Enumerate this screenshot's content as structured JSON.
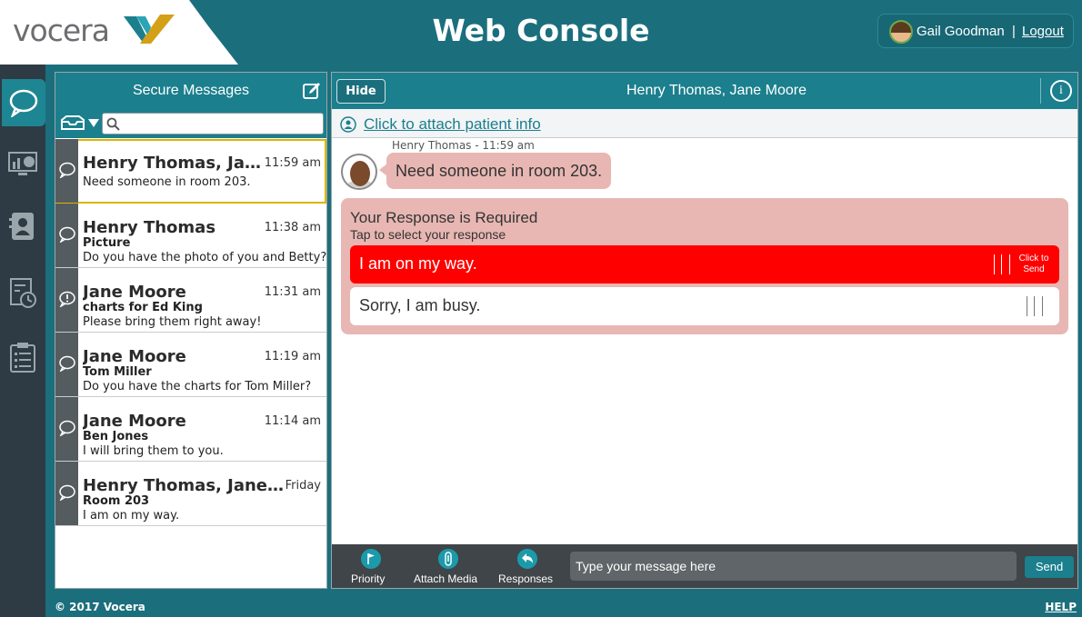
{
  "header": {
    "logo_text": "vocera",
    "app_title": "Web Console",
    "user_name": "Gail Goodman",
    "separator": "|",
    "logout_label": "Logout"
  },
  "nav": {
    "items": [
      {
        "name": "messages",
        "icon": "chat-bubble-icon",
        "active": true
      },
      {
        "name": "dashboard",
        "icon": "dashboard-chart-icon",
        "active": false
      },
      {
        "name": "contacts",
        "icon": "contact-card-icon",
        "active": false
      },
      {
        "name": "history",
        "icon": "history-clock-icon",
        "active": false
      },
      {
        "name": "tasks",
        "icon": "clipboard-icon",
        "active": false
      }
    ]
  },
  "list": {
    "title": "Secure Messages",
    "search_placeholder": "",
    "messages": [
      {
        "sender": "Henry Thomas, Jane Moore",
        "time": "11:59 am",
        "subject": "",
        "preview": "Need someone in room 203.",
        "icon": "chat-bubble-icon",
        "selected": true
      },
      {
        "sender": "Henry Thomas",
        "time": "11:38 am",
        "subject": "Picture",
        "preview": "Do you have the photo of you and Betty?",
        "icon": "chat-bubble-icon",
        "selected": false
      },
      {
        "sender": "Jane Moore",
        "time": "11:31 am",
        "subject": "charts for Ed King",
        "preview": "Please bring them right away!",
        "icon": "alert-bubble-icon",
        "selected": false
      },
      {
        "sender": "Jane Moore",
        "time": "11:19 am",
        "subject": "Tom Miller",
        "preview": "Do you have the charts for Tom Miller?",
        "icon": "chat-bubble-icon",
        "selected": false
      },
      {
        "sender": "Jane Moore",
        "time": "11:14 am",
        "subject": "Ben Jones",
        "preview": "I will bring them to you.",
        "icon": "chat-bubble-icon",
        "selected": false
      },
      {
        "sender": "Henry Thomas, Jane Moore",
        "time": "Friday",
        "subject": "Room 203",
        "preview": "I am on my way.",
        "icon": "chat-bubble-icon",
        "selected": false
      }
    ]
  },
  "conversation": {
    "hide_label": "Hide",
    "title": "Henry Thomas, Jane Moore",
    "info_label": "i",
    "attach_link": "Click to attach patient info",
    "message_meta": "Henry Thomas - 11:59 am",
    "message_text": "Need someone in room 203.",
    "response": {
      "title": "Your Response is Required",
      "subtitle": "Tap to select your response",
      "options": [
        {
          "label": "I am on my way.",
          "hint": "Click to Send",
          "color": "#ff0000"
        },
        {
          "label": "Sorry, I am busy.",
          "hint": "",
          "color": "#ffffff"
        }
      ]
    },
    "composer": {
      "tools": [
        {
          "label": "Priority",
          "icon": "flag-icon"
        },
        {
          "label": "Attach Media",
          "icon": "paperclip-icon"
        },
        {
          "label": "Responses",
          "icon": "reply-arrow-icon"
        }
      ],
      "input_placeholder": "Type your message here",
      "send_label": "Send"
    }
  },
  "footer": {
    "copyright": "© 2017 Vocera",
    "help_label": "HELP"
  },
  "colors": {
    "brand_teal": "#1b6f7d",
    "header_teal": "#1b7f8d",
    "bubble_pink": "#e8b7b3",
    "alert_red": "#ff0000",
    "selected_outline": "#d9b600"
  }
}
